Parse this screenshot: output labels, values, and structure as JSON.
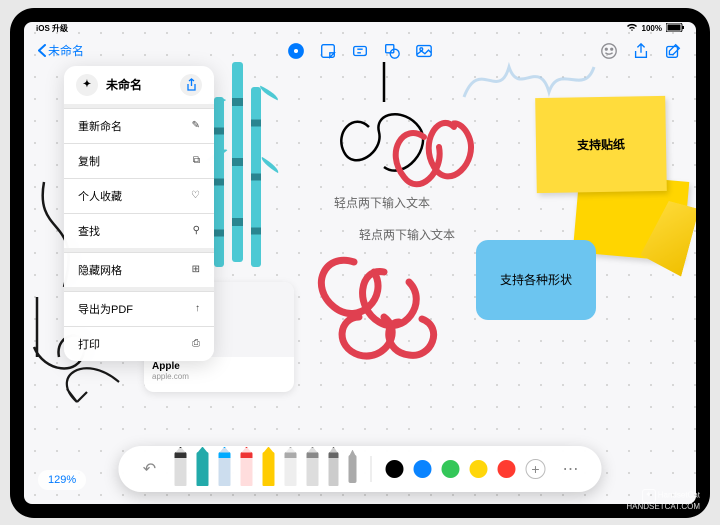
{
  "status": {
    "left_text": "iOS 升级",
    "battery": "100%"
  },
  "toolbar": {
    "back_label": "未命名"
  },
  "context_menu": {
    "title": "未命名",
    "items": [
      {
        "label": "重新命名",
        "icon": "✎"
      },
      {
        "label": "复制",
        "icon": "⧉"
      },
      {
        "label": "个人收藏",
        "icon": "♡"
      },
      {
        "label": "查找",
        "icon": "⚲"
      },
      {
        "label": "隐藏网格",
        "icon": "⊞"
      },
      {
        "label": "导出为PDF",
        "icon": "↑"
      },
      {
        "label": "打印",
        "icon": "⎙"
      }
    ]
  },
  "canvas": {
    "sticky_yellow": "支持贴纸",
    "shape_blue": "支持各种形状",
    "placeholder1": "轻点两下输入文本",
    "placeholder2": "轻点两下输入文本",
    "link_title": "Apple",
    "link_url": "apple.com"
  },
  "tool_tray": {
    "colors": [
      "#000000",
      "#0a84ff",
      "#34c759",
      "#ffd60a",
      "#ff3b30"
    ]
  },
  "zoom": "129%",
  "watermark": {
    "name": "HandsetCat",
    "url": "HANDSETCAT.COM"
  }
}
